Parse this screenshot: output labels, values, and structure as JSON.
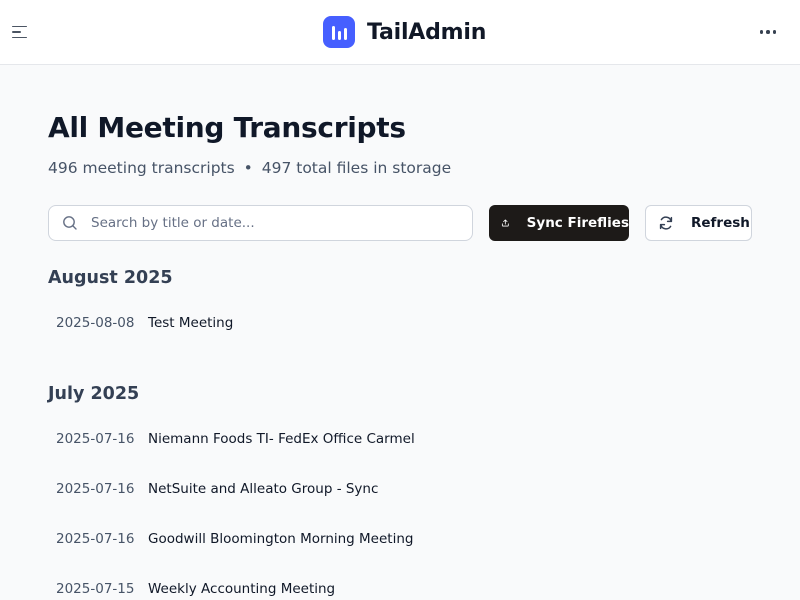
{
  "header": {
    "brand_name": "TailAdmin",
    "brand_color": "#465fff"
  },
  "page": {
    "title": "All Meeting Transcripts",
    "stats": {
      "transcripts": "496 meeting transcripts",
      "separator": "•",
      "files": "497 total files in storage"
    }
  },
  "toolbar": {
    "search_placeholder": "Search by title or date...",
    "search_value": "",
    "sync_label": "Sync Fireflies",
    "sync_icon": "upload-icon",
    "refresh_label": "Refresh",
    "refresh_icon": "refresh-icon",
    "sync_bg": "#1d1a18"
  },
  "groups": [
    {
      "month": "August 2025",
      "meetings": [
        {
          "date": "2025-08-08",
          "title": "Test Meeting"
        }
      ]
    },
    {
      "month": "July 2025",
      "meetings": [
        {
          "date": "2025-07-16",
          "title": "Niemann Foods TI- FedEx Office Carmel"
        },
        {
          "date": "2025-07-16",
          "title": "NetSuite and Alleato Group - Sync"
        },
        {
          "date": "2025-07-16",
          "title": "Goodwill Bloomington Morning Meeting"
        },
        {
          "date": "2025-07-15",
          "title": "Weekly Accounting Meeting"
        }
      ]
    }
  ]
}
